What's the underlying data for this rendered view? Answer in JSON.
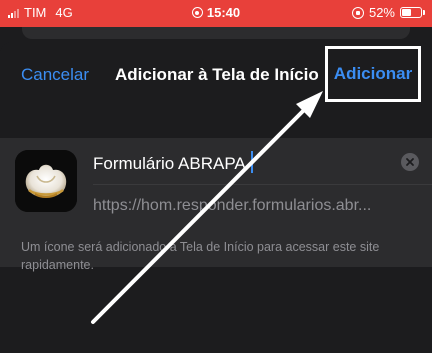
{
  "status_bar": {
    "carrier": "TIM",
    "network": "4G",
    "time": "15:40",
    "battery": "52%"
  },
  "nav": {
    "cancel_label": "Cancelar",
    "title": "Adicionar à Tela de Início",
    "add_label": "Adicionar"
  },
  "form": {
    "name_value": "Formulário ABRAPA",
    "url": "https://hom.responder.formularios.abr..."
  },
  "footer": {
    "note": "Um ícone será adicionado à Tela de Início para acessar este site rapidamente."
  },
  "colors": {
    "accent": "#3b8df2",
    "status_bar": "#e8403a",
    "background": "#1c1c1e",
    "card": "#2c2c2e"
  },
  "icons": [
    "signal-icon",
    "alarm-icon",
    "orientation-lock-icon",
    "battery-icon",
    "app-icon",
    "clear-icon",
    "annotation-arrow"
  ]
}
